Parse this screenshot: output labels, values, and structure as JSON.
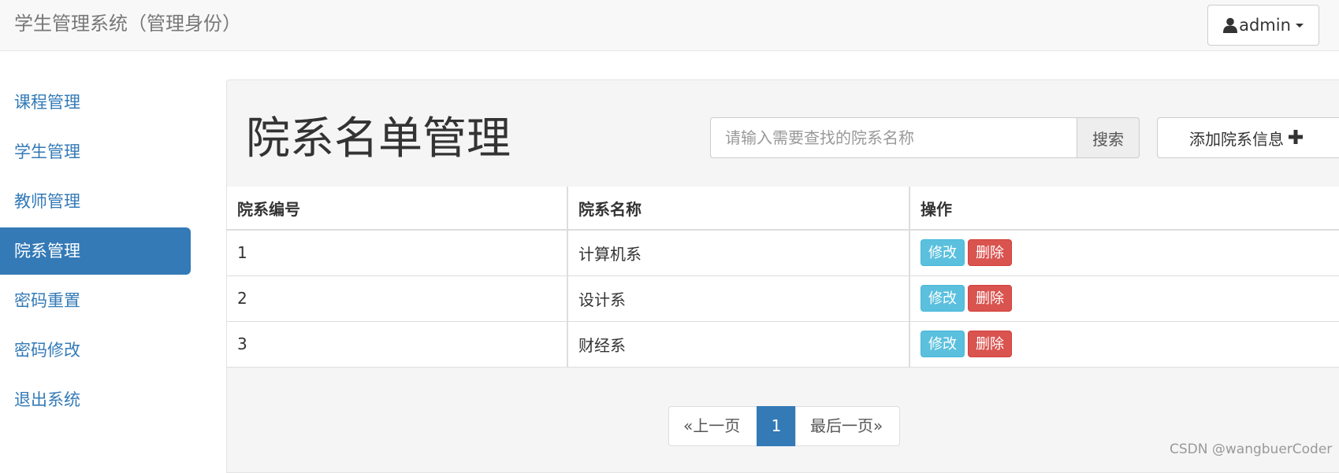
{
  "navbar": {
    "brand": "学生管理系统（管理身份）",
    "user": {
      "name": "admin",
      "icon": "user-icon"
    }
  },
  "sidebar": {
    "items": [
      {
        "label": "课程管理",
        "active": false
      },
      {
        "label": "学生管理",
        "active": false
      },
      {
        "label": "教师管理",
        "active": false
      },
      {
        "label": "院系管理",
        "active": true
      },
      {
        "label": "密码重置",
        "active": false
      },
      {
        "label": "密码修改",
        "active": false
      },
      {
        "label": "退出系统",
        "active": false
      }
    ]
  },
  "main": {
    "title": "院系名单管理",
    "search": {
      "placeholder": "请输入需要查找的院系名称",
      "value": "",
      "button": "搜索"
    },
    "add_button": {
      "label": "添加院系信息",
      "icon": "plus-icon"
    },
    "table": {
      "headers": [
        "院系编号",
        "院系名称",
        "操作"
      ],
      "rows": [
        {
          "id": "1",
          "name": "计算机系"
        },
        {
          "id": "2",
          "name": "设计系"
        },
        {
          "id": "3",
          "name": "财经系"
        }
      ],
      "actions": {
        "edit": "修改",
        "delete": "删除"
      }
    },
    "pagination": {
      "prev": "«上一页",
      "current": "1",
      "last": "最后一页»"
    }
  },
  "watermark": "CSDN @wangbuerCoder",
  "colors": {
    "primary": "#337ab7",
    "info": "#5bc0de",
    "danger": "#d9534f",
    "navbar_bg": "#f8f8f8",
    "panel_bg": "#f5f5f5"
  }
}
